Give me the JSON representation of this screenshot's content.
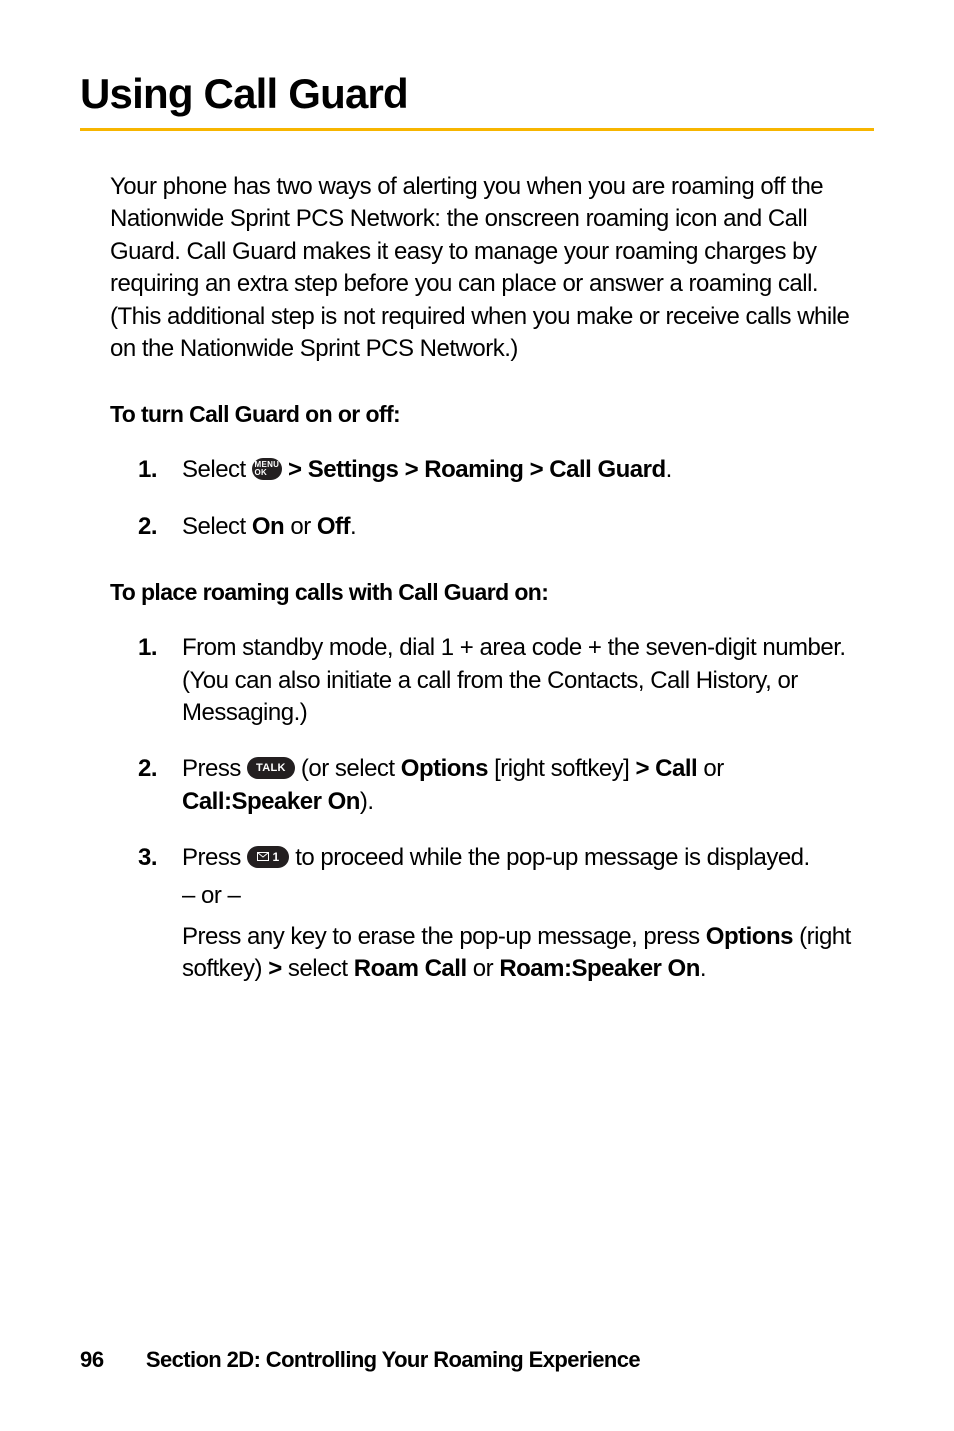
{
  "title": "Using Call Guard",
  "intro": "Your phone has two ways of alerting you when you are roaming off the Nationwide Sprint PCS Network: the onscreen roaming icon and Call Guard. Call Guard makes it easy to manage your roaming charges by requiring an extra step before you can place or answer a roaming call. (This additional step is not required when you make or receive calls while on the Nationwide Sprint PCS Network.)",
  "section_a": {
    "heading": "To turn Call Guard on or off:",
    "steps": {
      "s1": {
        "num": "1.",
        "pre": "Select ",
        "icon_menu_top": "MENU",
        "icon_menu_bot": "OK",
        "path": " > Settings > Roaming > Call Guard",
        "post": "."
      },
      "s2": {
        "num": "2.",
        "pre": "Select ",
        "on": "On",
        "mid": " or ",
        "off": "Off",
        "post": "."
      }
    }
  },
  "section_b": {
    "heading": "To place roaming calls with Call Guard on:",
    "steps": {
      "s1": {
        "num": "1.",
        "text": "From standby mode, dial 1 + area code + the seven-digit number. (You can also initiate a call from the Contacts, Call History, or Messaging.)"
      },
      "s2": {
        "num": "2.",
        "pre": "Press ",
        "talk": "TALK",
        "mid1": " (or select ",
        "options": "Options",
        "mid2": " [right softkey] ",
        "gt1": "> Call",
        "mid3": " or ",
        "speaker": "Call:Speaker On",
        "post": ")."
      },
      "s3": {
        "num": "3.",
        "pre": "Press ",
        "key1_digit": "1",
        "mid": " to proceed while the pop-up message is displayed.",
        "or": "– or –",
        "line2a": "Press any key to erase the pop-up message, press ",
        "options": "Options",
        "line2b": " (right softkey) ",
        "gt": ">",
        "line2c": " select ",
        "roamcall": "Roam Call",
        "line2d": " or ",
        "roamspeaker": "Roam:Speaker On",
        "post": "."
      }
    }
  },
  "footer": {
    "page": "96",
    "section": "Section 2D: Controlling Your Roaming Experience"
  }
}
